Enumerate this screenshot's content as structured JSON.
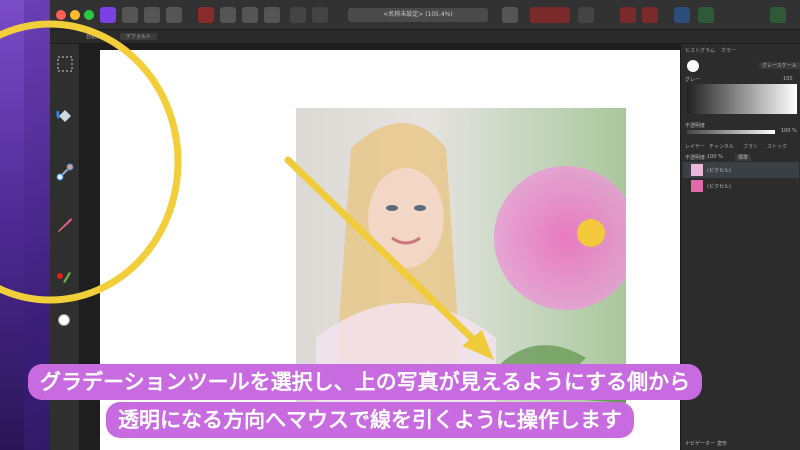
{
  "app": {
    "document_title": "<名称未設定> (105.4%)",
    "context_bar": {
      "left_label": "自動選択",
      "preset_label": "デフォルト"
    }
  },
  "panels": {
    "top_tabs": [
      "ヒストグラム",
      "カラー"
    ],
    "color_mode": "グレースケール",
    "gray_label": "グレー",
    "gray_value": "100",
    "opacity_label": "不透明度",
    "opacity_value": "100 %",
    "layer_tabs": [
      "レイヤー",
      "チャンネル",
      "ブラシ",
      "ストック"
    ],
    "layer_opacity_label": "不透明度:",
    "layer_opacity_value": "100 %",
    "blend_mode": "標準",
    "layers": [
      {
        "name": "(ピクセル)"
      },
      {
        "name": "(ピクセル)"
      }
    ],
    "bottom_tabs": [
      "ナビゲーター",
      "変形"
    ]
  },
  "caption": {
    "line1": "グラデーションツールを選択し、上の写真が見えるようにする側から",
    "line2": "透明になる方向へマウスで線を引くように操作します"
  },
  "colors": {
    "highlight": "#f2cf3a",
    "caption_bg": "#c86be0",
    "arrow": "#f0cc3c"
  },
  "icons": {
    "tools": [
      "marquee-icon",
      "fill-bucket-icon",
      "gradient-icon",
      "paint-brush-icon",
      "smudge-brush-icon"
    ]
  }
}
